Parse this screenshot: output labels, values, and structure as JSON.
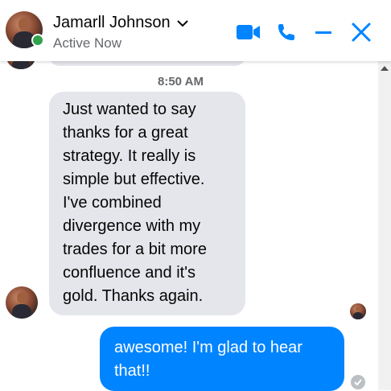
{
  "header": {
    "contact_name": "Jamarll Johnson",
    "status": "Active Now",
    "icons": [
      "video-call-icon",
      "phone-icon",
      "minimize-icon",
      "close-icon",
      "chevron-down-icon"
    ],
    "accent_color": "#0084ff",
    "active_color": "#31a24c"
  },
  "conversation": {
    "timestamp": "8:50 AM",
    "incoming": {
      "lines": [
        "Just wanted to say",
        "thanks for a great",
        "strategy. It really is",
        "simple but effective.",
        "I've combined",
        "divergence with my",
        "trades for a bit more",
        "confluence and it's",
        "gold. Thanks again."
      ]
    },
    "outgoing": {
      "lines": [
        "awesome! I'm glad to hear",
        "that!!"
      ]
    }
  }
}
